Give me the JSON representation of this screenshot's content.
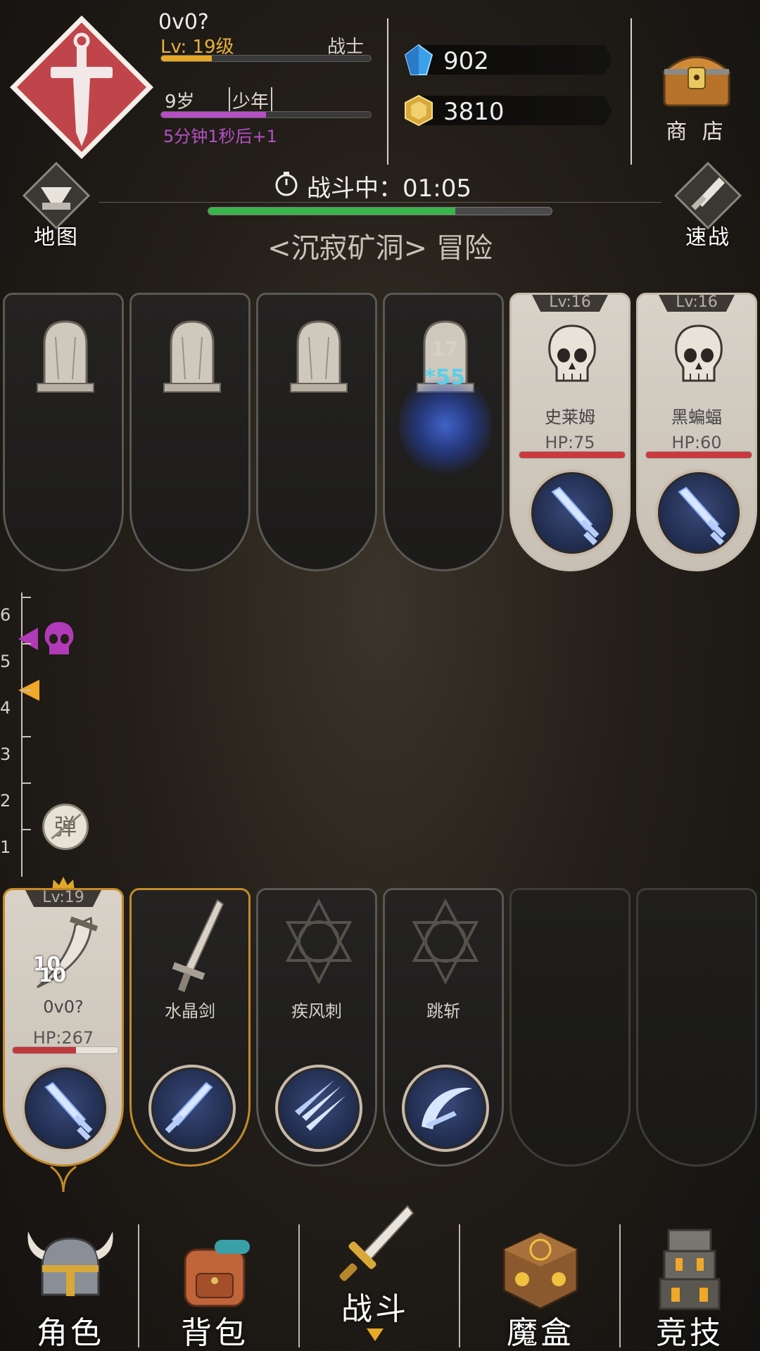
{
  "header": {
    "player_name": "0v0?",
    "level": "Lv: 19级",
    "class": "战士",
    "xp_progress": 0.24,
    "age": "9岁",
    "age_stage": "少年",
    "age_progress": 0.5,
    "age_timer": "5分钟1秒后+1",
    "gems": "902",
    "gold": "3810",
    "shop_label": "商 店"
  },
  "side": {
    "map_label": "地图",
    "quick_battle_label": "速战"
  },
  "battle": {
    "status": "战斗中：01:05",
    "progress": 0.72,
    "dungeon_title": "<沉寂矿洞> 冒险"
  },
  "enemies": [
    {
      "state": "dead"
    },
    {
      "state": "dead"
    },
    {
      "state": "dead"
    },
    {
      "state": "dead",
      "damage_top": "17",
      "damage_effect": "*55"
    },
    {
      "state": "alive",
      "level": "Lv:16",
      "name": "史莱姆",
      "hp": "HP:75",
      "hp_ratio": 1.0
    },
    {
      "state": "alive",
      "level": "Lv:16",
      "name": "黑蝙蝠",
      "hp": "HP:60",
      "hp_ratio": 1.0
    }
  ],
  "gauge": {
    "ticks": [
      "6",
      "5",
      "4",
      "3",
      "2",
      "1"
    ],
    "enemy_marker": 5.6,
    "player_marker": 4.5,
    "bullet_label": "弹"
  },
  "party": [
    {
      "type": "hero",
      "level": "Lv:19",
      "name": "0v0?",
      "hp": "HP:267",
      "hp_ratio": 0.6,
      "overlay_text": "10",
      "overlay_text2": "10"
    },
    {
      "type": "item",
      "name": "水晶剑"
    },
    {
      "type": "skill",
      "name": "疾风刺"
    },
    {
      "type": "skill",
      "name": "跳斩"
    },
    {
      "type": "empty"
    },
    {
      "type": "empty"
    }
  ],
  "nav": {
    "role": "角色",
    "bag": "背包",
    "battle": "战斗",
    "magic_box": "魔盒",
    "arena": "竞技"
  },
  "colors": {
    "xp": "#e8a823",
    "age": "#b64fc6",
    "hp": "#c0393c",
    "battle_progress": "#3ab54a",
    "badge_red": "#c0454a"
  }
}
